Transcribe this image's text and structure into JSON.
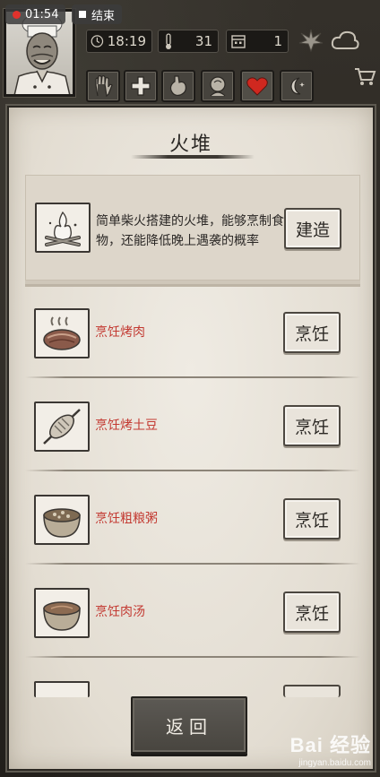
{
  "recording": {
    "time": "01:54",
    "end_label": "结束"
  },
  "hud": {
    "clock": "18:19",
    "temperature": "31",
    "day": "1",
    "icons": {
      "clock": "clock-icon",
      "temperature": "thermometer-icon",
      "day": "calendar-icon",
      "leaf": "leaf-icon",
      "weather": "cloud-icon",
      "shop": "cart-icon"
    }
  },
  "tabs": [
    {
      "name": "hand-icon"
    },
    {
      "name": "medical-cross-icon"
    },
    {
      "name": "stomach-icon"
    },
    {
      "name": "head-icon"
    },
    {
      "name": "heart-icon"
    },
    {
      "name": "moon-icon"
    }
  ],
  "panel": {
    "title": "火堆",
    "build": {
      "description": "简单柴火搭建的火堆，能够烹制食物，还能降低晚上遇袭的概率",
      "button": "建造",
      "icon": "campfire-icon"
    },
    "recipes": [
      {
        "name": "烹饪烤肉",
        "button": "烹饪",
        "icon": "roast-meat-icon"
      },
      {
        "name": "烹饪烤土豆",
        "button": "烹饪",
        "icon": "potato-skewer-icon"
      },
      {
        "name": "烹饪粗粮粥",
        "button": "烹饪",
        "icon": "porridge-bowl-icon"
      },
      {
        "name": "烹饪肉汤",
        "button": "烹饪",
        "icon": "soup-bowl-icon"
      }
    ],
    "back_button": "返回"
  },
  "watermark": {
    "main": "Bai 经验",
    "sub": "jingyan.baidu.com"
  },
  "colors": {
    "panel_bg": "#e7e2d9",
    "recipe_text": "#c33a32",
    "heart_tab": "#d0281f",
    "hud_bg": "#1b1916"
  }
}
